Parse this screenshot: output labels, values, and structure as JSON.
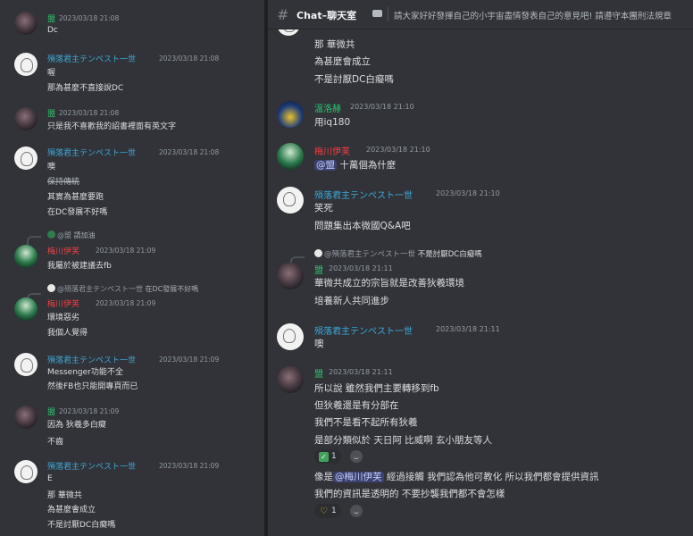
{
  "left": {
    "messages": [
      {
        "author": "盟",
        "time": "2023/03/18 21:08",
        "lines": [
          "Dc"
        ]
      },
      {
        "author": "殞落君主テンペスト一世",
        "time": "2023/03/18 21:08",
        "lines": [
          "喔",
          "那為甚麼不直接說DC"
        ]
      },
      {
        "author": "盟",
        "time": "2023/03/18 21:08",
        "lines": [
          "只是我不喜歡我的詔書裡面有英文字"
        ]
      },
      {
        "author": "殞落君主テンペスト一世",
        "time": "2023/03/18 21:08",
        "lines": [
          "噢",
          "保持傳統",
          "其實為甚麼要跑",
          "在DC發展不好嗎"
        ]
      },
      {
        "reply_mention": "@盟",
        "reply_text": "請加油",
        "author": "梅川伊芙",
        "time": "2023/03/18 21:09",
        "lines": [
          "我屬於被建議去fb"
        ]
      },
      {
        "reply_mention": "@殞落君主テンペスト一世",
        "reply_text": "在DC發展不好嗎",
        "author": "梅川伊芙",
        "time": "2023/03/18 21:09",
        "lines": [
          "環境惡劣",
          "我個人覺得"
        ]
      },
      {
        "author": "殞落君主テンペスト一世",
        "time": "2023/03/18 21:09",
        "lines": [
          "Messenger功能不全",
          "然後FB也只能開專頁而已"
        ]
      },
      {
        "author": "盟",
        "time": "2023/03/18 21:09",
        "lines": [
          "因為 狄羲多白癡",
          "不齒"
        ]
      },
      {
        "author": "殞落君主テンペスト一世",
        "time": "2023/03/18 21:09",
        "lines": [
          "E",
          "那 華微共",
          "為甚麼會成立",
          "不是討厭DC白癡嗎"
        ]
      }
    ]
  },
  "header": {
    "channel_name": "Chat–聊天室",
    "topic": "請大家好好發揮自己的小宇宙盡情發表自己的意見吧! 請遵守本團刑法規章"
  },
  "right": {
    "top_lines": [
      "那 華微共",
      "為甚麼會成立",
      "不是討厭DC白癡嗎"
    ],
    "messages": [
      {
        "author": "溫洛赫",
        "time": "2023/03/18 21:10",
        "lines": [
          "用iq180"
        ]
      },
      {
        "author": "梅川伊芙",
        "time": "2023/03/18 21:10",
        "mention": "@盟",
        "after_mention": " 十萬個為什麼"
      },
      {
        "author": "殞落君主テンペスト一世",
        "time": "2023/03/18 21:10",
        "lines": [
          "笑死",
          "問題集出本微國Q&A吧"
        ]
      },
      {
        "reply_mention": "@殞落君主テンペスト一世",
        "reply_text": "不是討厭DC白癡嗎",
        "author": "盟",
        "time": "2023/03/18 21:11",
        "lines": [
          "華微共成立的宗旨就是改善狄羲環境",
          "培養新人共同進步"
        ]
      },
      {
        "author": "殞落君主テンペスト一世",
        "time": "2023/03/18 21:11",
        "lines": [
          "噢"
        ]
      },
      {
        "author": "盟",
        "time": "2023/03/18 21:11",
        "lines": [
          "所以說 雖然我們主要轉移到fb",
          "但狄羲還是有分部在",
          "我們不是看不起所有狄羲",
          "是部分類似於 天日阿 比威啊 玄小朋友等人"
        ],
        "reaction1": {
          "emoji": "check-emoji",
          "count": "1"
        },
        "line_with_mention": {
          "before": "像是",
          "mention": "@梅川伊芙",
          "after": " 經過接觸 我們認為他可教化 所以我們都會提供資訊"
        },
        "last_line": "我們的資訊是透明的 不要抄襲我們都不會怎樣",
        "reaction2": {
          "emoji": "ok-hand-emoji",
          "count": "1"
        }
      }
    ]
  },
  "colors": {
    "green": "#2dc770",
    "blue": "#3ea8d7",
    "red": "#f23f43",
    "background": "#313338"
  }
}
